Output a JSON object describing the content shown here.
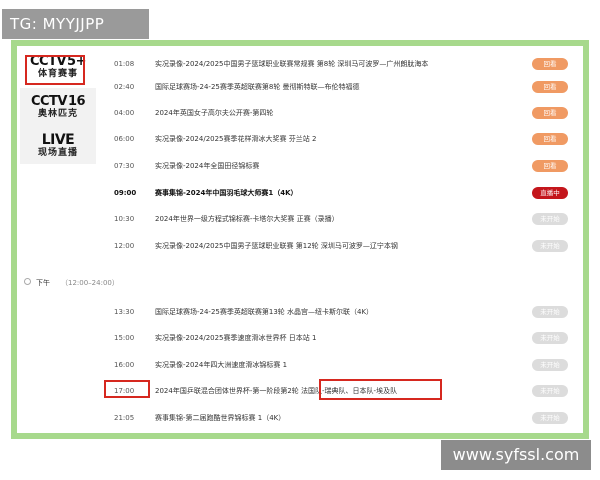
{
  "tag": "TG: MYYJJPP",
  "watermark": "www.syfssl.com",
  "colors": {
    "frame": "#a7d98c",
    "replay": "#f09a63",
    "live": "#c4161c",
    "not_started": "#dcdcdc",
    "highlight": "#d6281f"
  },
  "sidebar": {
    "channels": [
      {
        "main": "CCTV",
        "num": "5+",
        "sub": "体育赛事"
      },
      {
        "main": "CCTV",
        "num": "16",
        "sub": "奥林匹克"
      },
      {
        "main": "LIVE",
        "num": "",
        "sub": "现场直播"
      }
    ]
  },
  "schedule": {
    "rows": [
      {
        "time": "01:08",
        "title": "实况录像-2024/2025中国男子篮球职业联赛常规赛 第8轮 深圳马可波罗—广州朗肽海本",
        "status": "回看"
      },
      {
        "time": "02:40",
        "title": "国际足球赛场-24-25赛季英超联赛第8轮 曼彻斯特联—布伦特福德",
        "status": "回看"
      },
      {
        "time": "04:00",
        "title": "2024年英国女子高尔夫公开赛-第四轮",
        "status": "回看"
      },
      {
        "time": "06:00",
        "title": "实况录像-2024/2025赛季花样滑冰大奖赛 芬兰站 2",
        "status": "回看"
      },
      {
        "time": "07:30",
        "title": "实况录像-2024年全国田径锦标赛",
        "status": "回看"
      },
      {
        "time": "09:00",
        "title": "赛事集锦-2024年中国羽毛球大师赛1（4K）",
        "status": "直播中"
      },
      {
        "time": "10:30",
        "title": "2024年世界一级方程式锦标赛-卡塔尔大奖赛 正赛（录播）",
        "status": "未开始"
      },
      {
        "time": "12:00",
        "title": "实况录像-2024/2025中国男子篮球职业联赛 第12轮 深圳马可波罗—辽宁本钢",
        "status": "未开始"
      }
    ],
    "afternoon_label": "下午",
    "afternoon_range": "（12:00–24:00）",
    "rows_pm": [
      {
        "time": "13:30",
        "title": "国际足球赛场-24-25赛季英超联赛第13轮 水晶宫—纽卡斯尔联（4K）",
        "status": "未开始"
      },
      {
        "time": "15:00",
        "title": "实况录像-2024/2025赛季速度滑冰世界杯 日本站 1",
        "status": "未开始"
      },
      {
        "time": "16:00",
        "title": "实况录像-2024年四大洲速度滑冰锦标赛 1",
        "status": "未开始"
      },
      {
        "time": "17:00",
        "title": "2024年国乒联混合团体世界杯-第一阶段第2轮 法国队-瑞典队、日本队-埃及队",
        "status": "未开始"
      },
      {
        "time": "21:05",
        "title": "赛事集锦-第二届跑酷世界锦标赛 1（4K）",
        "status": "未开始"
      }
    ]
  }
}
